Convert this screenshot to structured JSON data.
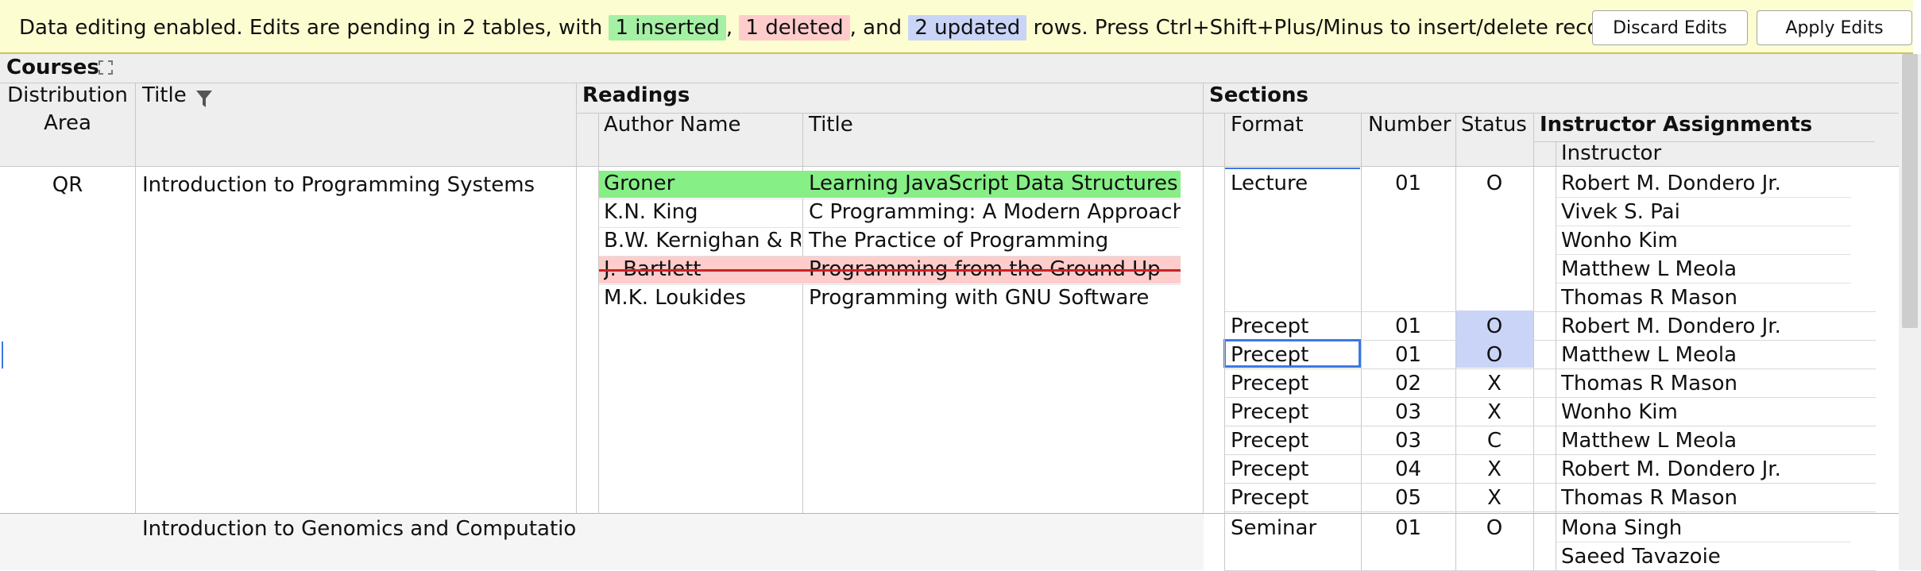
{
  "banner": {
    "text_pre": "Data editing enabled. Edits are pending in 2 tables, with",
    "inserted": "1 inserted",
    "sep1": ",",
    "deleted": "1 deleted",
    "sep2": ", and",
    "updated": "2 updated",
    "text_post": "rows. Press Ctrl+Shift+Plus/Minus to insert/delete records.",
    "discard_label": "Discard Edits",
    "apply_label": "Apply Edits"
  },
  "headers": {
    "courses": "Courses",
    "distribution_area_1": "Distribution",
    "distribution_area_2": "Area",
    "title": "Title",
    "readings": "Readings",
    "author_name": "Author Name",
    "reading_title": "Title",
    "sections": "Sections",
    "format": "Format",
    "number": "Number",
    "status": "Status",
    "instructor_assignments": "Instructor Assignments",
    "instructor": "Instructor"
  },
  "course1": {
    "distribution_area": "QR",
    "title": "Introduction to Programming Systems",
    "readings": [
      {
        "author": "Groner",
        "title": "Learning JavaScript Data Structures and Algorithms",
        "state": "inserted"
      },
      {
        "author": "K.N. King",
        "title": "C Programming: A Modern Approach",
        "state": "normal"
      },
      {
        "author": "B.W. Kernighan & R. Pike",
        "title": "The Practice of Programming",
        "state": "normal"
      },
      {
        "author": "J. Bartlett",
        "title": "Programming from the Ground Up",
        "state": "deleted"
      },
      {
        "author": "M.K. Loukides",
        "title": "Programming with GNU Software",
        "state": "normal"
      }
    ],
    "sections": [
      {
        "format": "Lecture",
        "number": "01",
        "status": "O",
        "instructors": [
          "Robert M. Dondero Jr.",
          "Vivek S. Pai",
          "Wonho Kim",
          "Matthew L Meola",
          "Thomas R Mason"
        ]
      },
      {
        "format": "Precept",
        "number": "01",
        "status": "O",
        "status_updated": true,
        "instructors": [
          "Robert M. Dondero Jr."
        ]
      },
      {
        "format": "Precept",
        "number": "01",
        "status": "O",
        "status_updated": true,
        "selected": true,
        "instructors": [
          "Matthew L Meola"
        ]
      },
      {
        "format": "Precept",
        "number": "02",
        "status": "X",
        "instructors": [
          "Thomas R Mason"
        ]
      },
      {
        "format": "Precept",
        "number": "03",
        "status": "X",
        "instructors": [
          "Wonho Kim"
        ]
      },
      {
        "format": "Precept",
        "number": "03",
        "status": "C",
        "instructors": [
          "Matthew L Meola"
        ]
      },
      {
        "format": "Precept",
        "number": "04",
        "status": "X",
        "instructors": [
          "Robert M. Dondero Jr."
        ]
      },
      {
        "format": "Precept",
        "number": "05",
        "status": "X",
        "instructors": [
          "Thomas R Mason"
        ]
      }
    ]
  },
  "course2": {
    "title": "Introduction to Genomics and Computational Molecular Biology",
    "sections": [
      {
        "format": "Seminar",
        "number": "01",
        "status": "O",
        "instructors": [
          "Mona Singh",
          "Saeed Tavazoie"
        ]
      }
    ]
  },
  "colors": {
    "inserted": "#86ef86",
    "deleted": "#ffcccc",
    "updated": "#c9d4f7",
    "selection": "#3b78e7",
    "header_bg": "#eeeeee",
    "banner_bg": "#fdfdd2"
  }
}
